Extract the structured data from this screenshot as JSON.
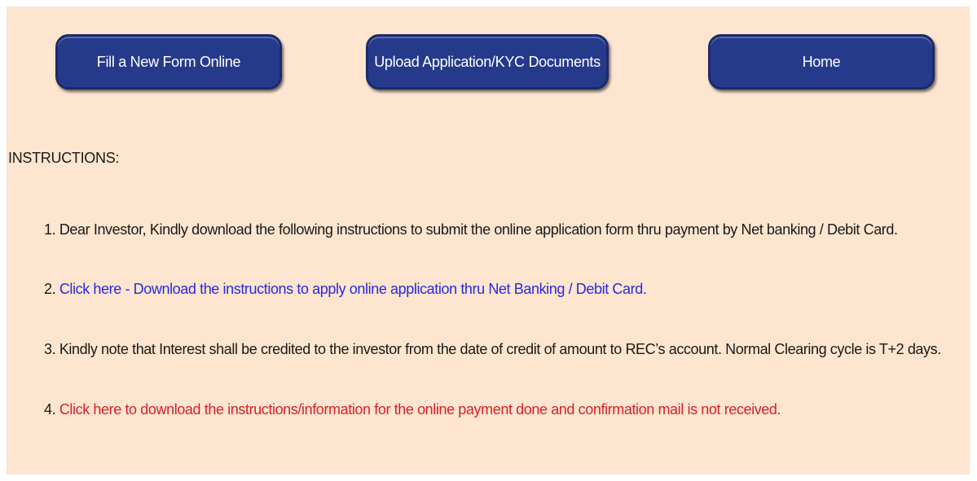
{
  "nav": {
    "fill_form": "Fill a New Form Online",
    "upload_docs": "Upload Application/KYC Documents",
    "home": "Home"
  },
  "colors": {
    "background": "#fde5cf",
    "button": "#263a8c",
    "link_blue": "#2a2ae0",
    "link_red": "#d8202a"
  },
  "instructions": {
    "heading": "INSTRUCTIONS:",
    "items": [
      {
        "num": "1.",
        "text": "Dear Investor, Kindly download the following instructions to submit the online application form thru payment by Net banking / Debit Card."
      },
      {
        "num": "2.",
        "link": "Click here - Download the instructions to apply online application thru Net Banking / Debit Card."
      },
      {
        "num": "3.",
        "text": "Kindly note that Interest shall be credited to the investor from the date of credit of amount to REC’s account. Normal Clearing cycle is T+2 days."
      },
      {
        "num": "4.",
        "link": "Click here to download the instructions/information for the online payment done and confirmation mail is not received."
      }
    ]
  }
}
